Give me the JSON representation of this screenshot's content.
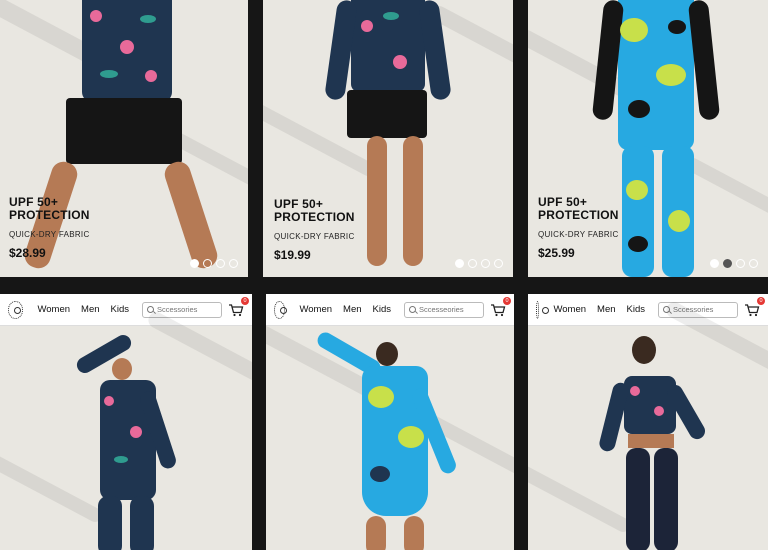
{
  "top_row": [
    {
      "title_line1": "UPF 50+",
      "title_line2": "PROTECTION",
      "subtitle": "QUICK-DRY FABRIC",
      "price": "$28.99",
      "carousel": {
        "count": 4,
        "active": 0
      }
    },
    {
      "title_line1": "UPF 50+",
      "title_line2": "PROTECTION",
      "subtitle": "QUICK-DRY FABRIC",
      "price": "$19.99",
      "carousel": {
        "count": 4,
        "active": 0
      }
    },
    {
      "title_line1": "UPF 50+",
      "title_line2": "PROTECTION",
      "subtitle": "QUICK-DRY FABRIC",
      "price": "$25.99",
      "carousel": {
        "count": 4,
        "active": 1
      }
    }
  ],
  "bottom_row": [
    {
      "nav": {
        "women": "Women",
        "men": "Men",
        "kids": "Kids"
      },
      "search_placeholder": "Sccessories",
      "cart_count": "0"
    },
    {
      "nav": {
        "women": "Women",
        "men": "Men",
        "kids": "Kids"
      },
      "search_placeholder": "Sccesseories",
      "cart_count": "0"
    },
    {
      "nav": {
        "women": "Women",
        "men": "Men",
        "kids": "Kids"
      },
      "search_placeholder": "Sccessories",
      "cart_count": "0"
    }
  ],
  "colors": {
    "navy_floral": "#1f3550",
    "pink_flower": "#e86a9a",
    "teal_leaf": "#2f9c8f",
    "cyan": "#27a9e1",
    "lime": "#c8e04a",
    "black": "#151515",
    "skin": "#b57a55",
    "backdrop": "#e9e7e1"
  },
  "icons": [
    "logo-icon",
    "search-icon",
    "cart-icon"
  ]
}
